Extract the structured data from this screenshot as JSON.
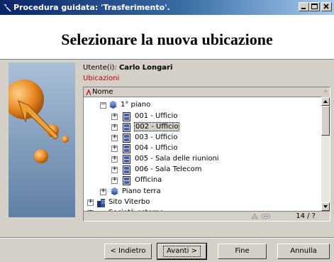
{
  "window": {
    "title": "Procedura guidata: 'Trasferimento'."
  },
  "header": {
    "title": "Selezionare la nuova ubicazione"
  },
  "user": {
    "label": "Utente(i):",
    "name": "Carlo Longari"
  },
  "locations": {
    "label": "Ubicazioni",
    "column_header": "Nome",
    "status_count": "14 / ?",
    "rows": [
      {
        "label": "1° piano",
        "expander": "−",
        "icon": "stack-icon"
      },
      {
        "label": "001 - Ufficio",
        "expander": "+",
        "icon": "room-icon"
      },
      {
        "label": "002 - Ufficio",
        "expander": "+",
        "icon": "room-icon",
        "selected": true
      },
      {
        "label": "003 - Ufficio",
        "expander": "+",
        "icon": "room-icon"
      },
      {
        "label": "004 - Ufficio",
        "expander": "+",
        "icon": "room-icon"
      },
      {
        "label": "005 - Sala delle riunioni",
        "expander": "+",
        "icon": "room-icon"
      },
      {
        "label": "006 - Sala Telecom",
        "expander": "+",
        "icon": "room-icon"
      },
      {
        "label": "Officina",
        "expander": "+",
        "icon": "room-icon"
      },
      {
        "label": "Piano terra",
        "expander": "+",
        "icon": "stack-icon"
      },
      {
        "label": "Sito Viterbo",
        "expander": "+",
        "icon": "building-icon"
      },
      {
        "label": "Società esterne",
        "expander": "+",
        "icon": ""
      }
    ]
  },
  "buttons": {
    "back": "< Indietro",
    "next": "Avanti >",
    "finish": "Fine",
    "cancel": "Annulla"
  },
  "colors": {
    "title_start": "#0a246a",
    "title_end": "#a6caf0",
    "accent_red": "#c00000",
    "face": "#d4d0c8"
  }
}
